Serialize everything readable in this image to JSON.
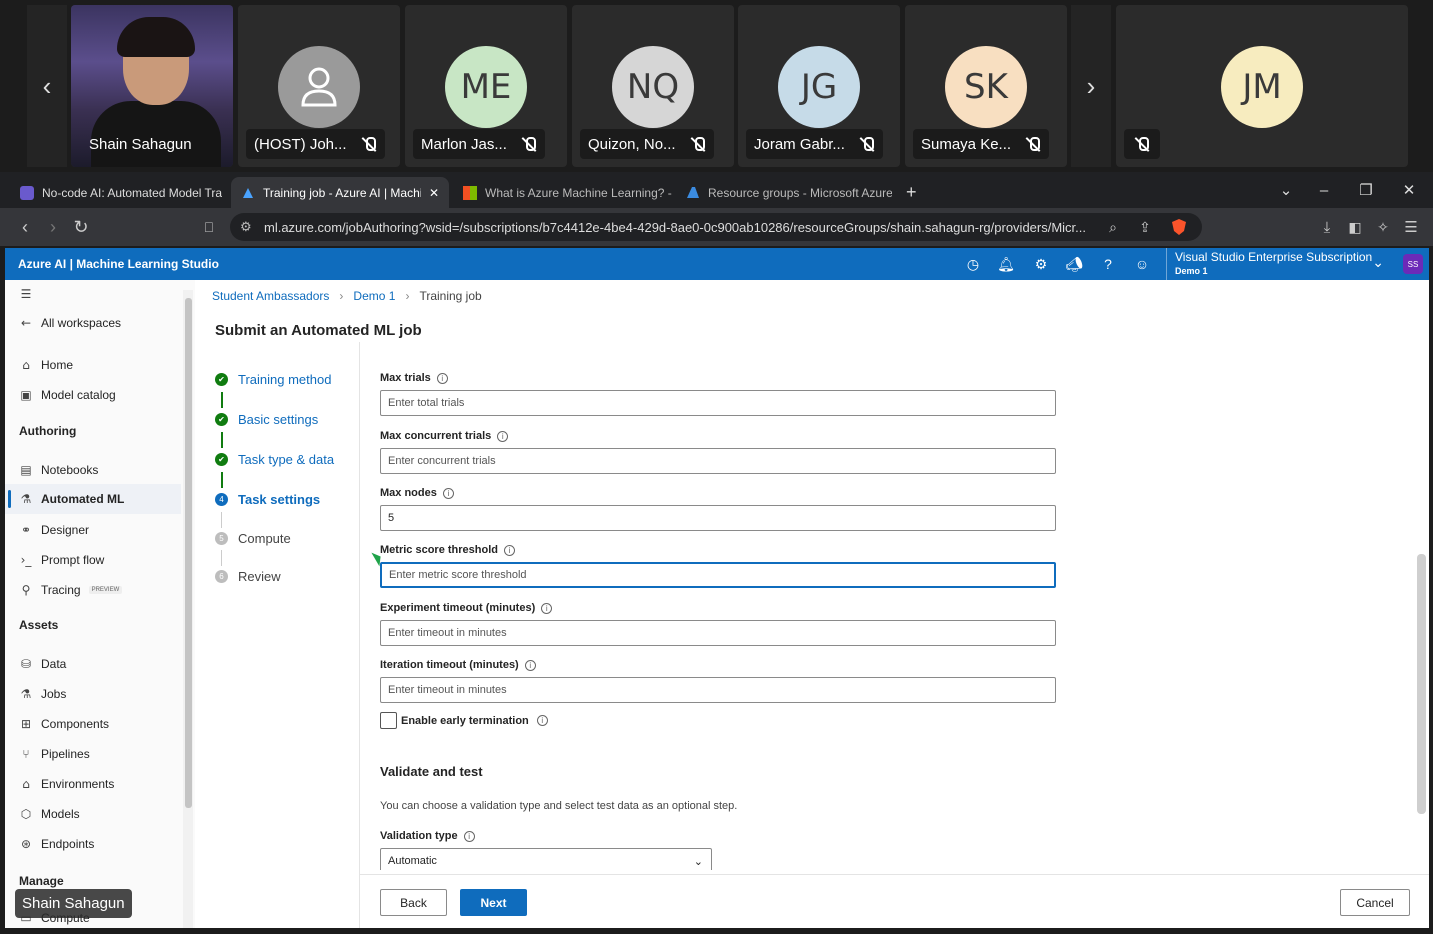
{
  "meeting": {
    "participants": [
      {
        "name": "Shain Sahagun",
        "initials": "",
        "muted": false,
        "video": true
      },
      {
        "name": "(HOST) Joh...",
        "initials": "",
        "muted": true,
        "avatar_color": "#9a9a9a"
      },
      {
        "name": "Marlon Jas...",
        "initials": "ME",
        "muted": true,
        "avatar_color": "#c8e6c5"
      },
      {
        "name": "Quizon, No...",
        "initials": "NQ",
        "muted": true,
        "avatar_color": "#d6d6d6"
      },
      {
        "name": "Joram Gabr...",
        "initials": "JG",
        "muted": true,
        "avatar_color": "#c6dbe8"
      },
      {
        "name": "Sumaya Ke...",
        "initials": "SK",
        "muted": true,
        "avatar_color": "#f8dfc1"
      },
      {
        "name": "",
        "initials": "JM",
        "muted": true,
        "avatar_color": "#f7ecbf"
      }
    ],
    "presenter_label": "Shain Sahagun"
  },
  "browser": {
    "tabs": [
      {
        "title": "No-code AI: Automated Model Trai",
        "active": false
      },
      {
        "title": "Training job - Azure AI | Machin",
        "active": true
      },
      {
        "title": "What is Azure Machine Learning? -",
        "active": false
      },
      {
        "title": "Resource groups - Microsoft Azure",
        "active": false
      }
    ],
    "url": "ml.azure.com/jobAuthoring?wsid=/subscriptions/b7c4412e-4be4-429d-8ae0-0c900ab10286/resourceGroups/shain.sahagun-rg/providers/Micr..."
  },
  "header": {
    "brand": "Azure AI | Machine Learning Studio",
    "subscription": "Visual Studio Enterprise Subscription",
    "workspace": "Demo 1",
    "user_initials": "SS"
  },
  "sidebar": {
    "back": "All workspaces",
    "items_top": [
      {
        "label": "Home",
        "icon": "home-icon"
      },
      {
        "label": "Model catalog",
        "icon": "catalog-icon"
      }
    ],
    "authoring_title": "Authoring",
    "authoring": [
      {
        "label": "Notebooks",
        "icon": "notebook-icon"
      },
      {
        "label": "Automated ML",
        "icon": "automl-icon",
        "active": true
      },
      {
        "label": "Designer",
        "icon": "designer-icon"
      },
      {
        "label": "Prompt flow",
        "icon": "promptflow-icon"
      },
      {
        "label": "Tracing",
        "icon": "tracing-icon",
        "badge": "PREVIEW"
      }
    ],
    "assets_title": "Assets",
    "assets": [
      {
        "label": "Data",
        "icon": "data-icon"
      },
      {
        "label": "Jobs",
        "icon": "jobs-icon"
      },
      {
        "label": "Components",
        "icon": "components-icon"
      },
      {
        "label": "Pipelines",
        "icon": "pipelines-icon"
      },
      {
        "label": "Environments",
        "icon": "environments-icon"
      },
      {
        "label": "Models",
        "icon": "models-icon"
      },
      {
        "label": "Endpoints",
        "icon": "endpoints-icon"
      }
    ],
    "manage_title": "Manage",
    "manage": [
      {
        "label": "Compute",
        "icon": "compute-icon"
      }
    ]
  },
  "breadcrumb": [
    "Student Ambassadors",
    "Demo 1",
    "Training job"
  ],
  "page_title": "Submit an Automated ML job",
  "steps": [
    {
      "label": "Training method",
      "state": "done",
      "num": "✔"
    },
    {
      "label": "Basic settings",
      "state": "done",
      "num": "✔"
    },
    {
      "label": "Task type & data",
      "state": "done",
      "num": "✔"
    },
    {
      "label": "Task settings",
      "state": "current",
      "num": "4"
    },
    {
      "label": "Compute",
      "state": "todo",
      "num": "5"
    },
    {
      "label": "Review",
      "state": "todo",
      "num": "6"
    }
  ],
  "form": {
    "max_trials": {
      "label": "Max trials",
      "placeholder": "Enter total trials",
      "value": ""
    },
    "max_concurrent": {
      "label": "Max concurrent trials",
      "placeholder": "Enter concurrent trials",
      "value": ""
    },
    "max_nodes": {
      "label": "Max nodes",
      "value": "5"
    },
    "metric_threshold": {
      "label": "Metric score threshold",
      "placeholder": "Enter metric score threshold",
      "value": ""
    },
    "experiment_timeout": {
      "label": "Experiment timeout (minutes)",
      "placeholder": "Enter timeout in minutes",
      "value": ""
    },
    "iteration_timeout": {
      "label": "Iteration timeout (minutes)",
      "placeholder": "Enter timeout in minutes",
      "value": ""
    },
    "early_termination": {
      "label": "Enable early termination",
      "checked": false
    },
    "validate_title": "Validate and test",
    "validate_help": "You can choose a validation type and select test data as an optional step.",
    "validation_type": {
      "label": "Validation type",
      "value": "Automatic"
    }
  },
  "footer": {
    "back": "Back",
    "next": "Next",
    "cancel": "Cancel"
  }
}
